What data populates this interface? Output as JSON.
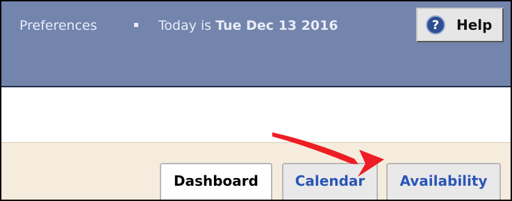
{
  "topbar": {
    "preferences_label": "Preferences",
    "today_prefix": "Today is",
    "today_date": "Tue Dec 13 2016",
    "help_label": "Help",
    "help_icon": "question-mark-circle-icon",
    "help_icon_glyph": "?",
    "background_color": "#7384ad"
  },
  "tabs": [
    {
      "label": "Dashboard",
      "active": true
    },
    {
      "label": "Calendar",
      "active": false
    },
    {
      "label": "Availability",
      "active": false
    }
  ],
  "annotation": {
    "type": "red-arrow",
    "points_to": "Availability",
    "color": "#ee1d24"
  }
}
